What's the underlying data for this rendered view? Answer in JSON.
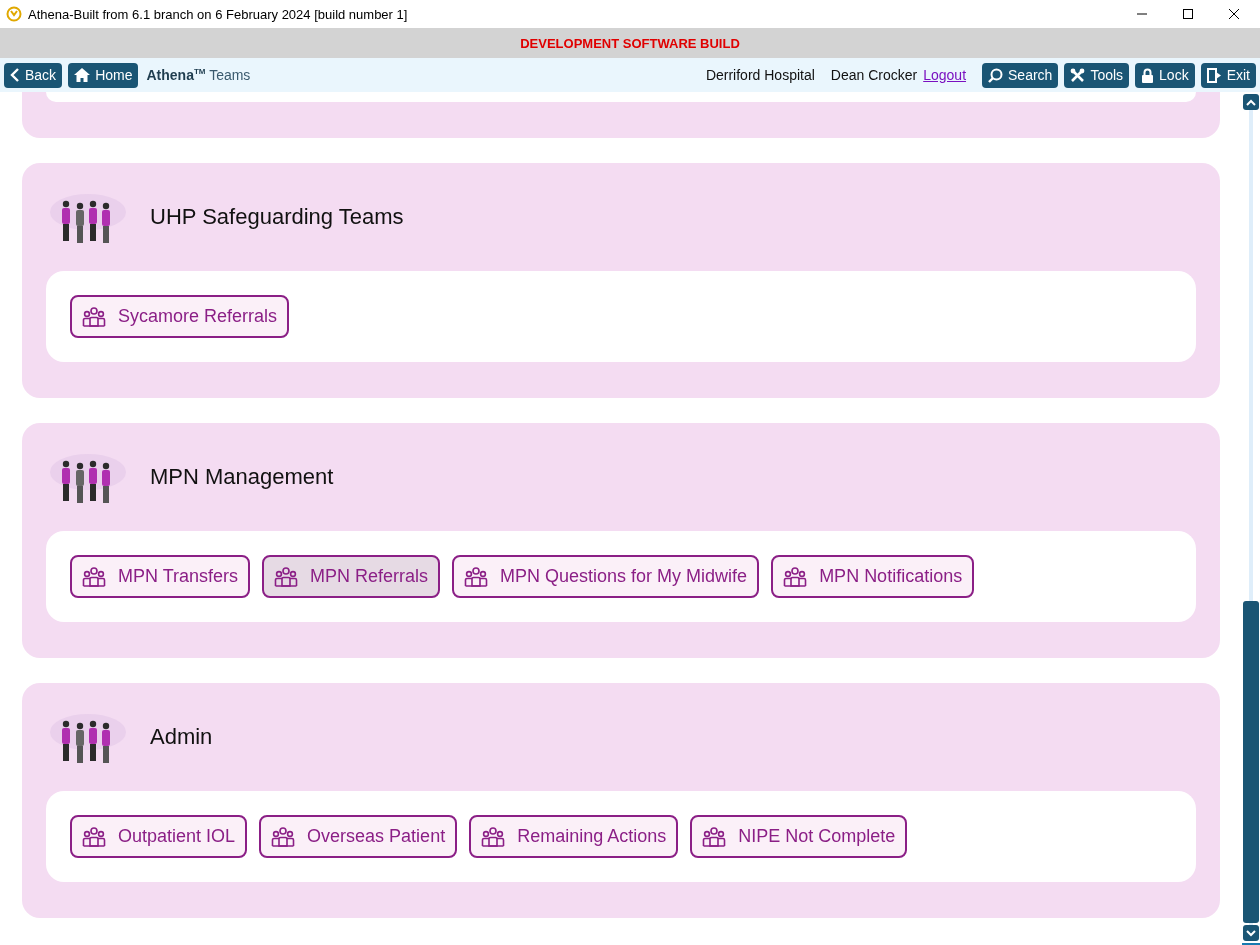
{
  "window": {
    "title": "Athena-Built from 6.1 branch on 6 February 2024 [build number 1]"
  },
  "banner": "DEVELOPMENT SOFTWARE BUILD",
  "toolbar": {
    "left_buttons": [
      {
        "kind": "back",
        "label": "Back"
      },
      {
        "kind": "home",
        "label": "Home"
      }
    ],
    "brand": "Athena",
    "brand_mark": "TM",
    "page": "Teams",
    "location": "Derriford Hospital",
    "user": "Dean Crocker",
    "logout": "Logout",
    "right_buttons": [
      {
        "kind": "search",
        "label": "Search"
      },
      {
        "kind": "tools",
        "label": "Tools"
      },
      {
        "kind": "lock",
        "label": "Lock"
      },
      {
        "kind": "exit",
        "label": "Exit"
      }
    ]
  },
  "groups": [
    {
      "title": "UHP Safeguarding Teams",
      "teams": [
        {
          "label": "Sycamore Referrals",
          "selected": false
        }
      ]
    },
    {
      "title": "MPN Management",
      "teams": [
        {
          "label": "MPN Transfers",
          "selected": false
        },
        {
          "label": "MPN Referrals",
          "selected": true
        },
        {
          "label": "MPN Questions for My Midwife",
          "selected": false
        },
        {
          "label": "MPN Notifications",
          "selected": false
        }
      ]
    },
    {
      "title": "Admin",
      "teams": [
        {
          "label": "Outpatient IOL",
          "selected": false
        },
        {
          "label": "Overseas Patient",
          "selected": false
        },
        {
          "label": "Remaining Actions",
          "selected": false
        },
        {
          "label": "NIPE Not Complete",
          "selected": false
        }
      ]
    }
  ]
}
